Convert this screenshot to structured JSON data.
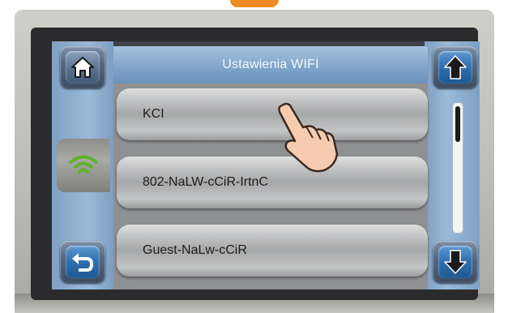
{
  "header": {
    "title": "Ustawienia WIFI"
  },
  "networks": [
    {
      "ssid": "KCI"
    },
    {
      "ssid": "802-NaLW-cCiR-IrtnC"
    },
    {
      "ssid": "Guest-NaLw-cCiR"
    }
  ],
  "scroll": {
    "position_fraction": 0.0
  },
  "icons": {
    "home": "home-icon",
    "wifi": "wifi-icon",
    "back": "back-arrow-icon",
    "up": "arrow-up-icon",
    "down": "arrow-down-icon",
    "hand": "pointing-hand-icon"
  },
  "colors": {
    "wifi_green": "#5fb52e",
    "title_text": "#f4f8fc",
    "button_blue": "#2f6fae"
  }
}
